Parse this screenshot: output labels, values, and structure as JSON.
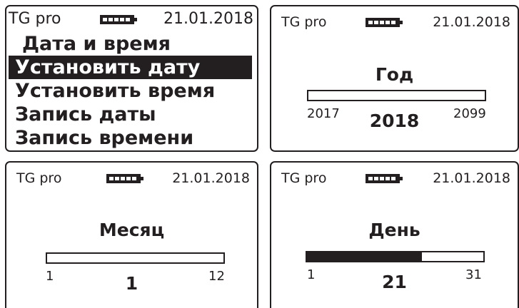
{
  "screen_menu": {
    "app_name": "TG pro",
    "date": "21.01.2018",
    "battery_icon": "battery-full-icon",
    "items": [
      {
        "label": "Дата и время",
        "role": "header"
      },
      {
        "label": "Установить дату",
        "role": "selected"
      },
      {
        "label": "Установить время"
      },
      {
        "label": "Запись даты"
      },
      {
        "label": "Запись времени"
      }
    ]
  },
  "screen_year": {
    "app_name": "TG pro",
    "date": "21.01.2018",
    "title": "Год",
    "min": "2017",
    "max": "2099",
    "value": "2018",
    "fill_fraction": 0
  },
  "screen_month": {
    "app_name": "TG pro",
    "date": "21.01.2018",
    "title": "Месяц",
    "min": "1",
    "max": "12",
    "value": "1",
    "fill_fraction": 0
  },
  "screen_day": {
    "app_name": "TG pro",
    "date": "21.01.2018",
    "title": "День",
    "min": "1",
    "max": "31",
    "value": "21",
    "fill_fraction": 0.65
  }
}
